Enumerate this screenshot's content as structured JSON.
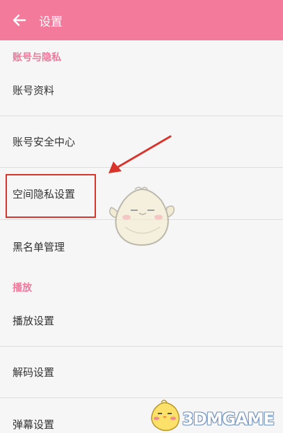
{
  "header": {
    "title": "设置",
    "back_icon": "arrow-left-icon"
  },
  "sections": {
    "account": {
      "title": "账号与隐私",
      "items": [
        "账号资料",
        "账号安全中心",
        "空间隐私设置",
        "黑名单管理"
      ]
    },
    "playback": {
      "title": "播放",
      "items": [
        "播放设置",
        "解码设置",
        "弹幕设置"
      ]
    }
  },
  "annotation": {
    "highlight_color": "#d9342b",
    "arrow_color": "#d9342b"
  },
  "watermark": {
    "text": "3DMGAME"
  },
  "colors": {
    "accent": "#f47a9c",
    "section_title": "#f0779b",
    "background": "#f6f6f6"
  }
}
